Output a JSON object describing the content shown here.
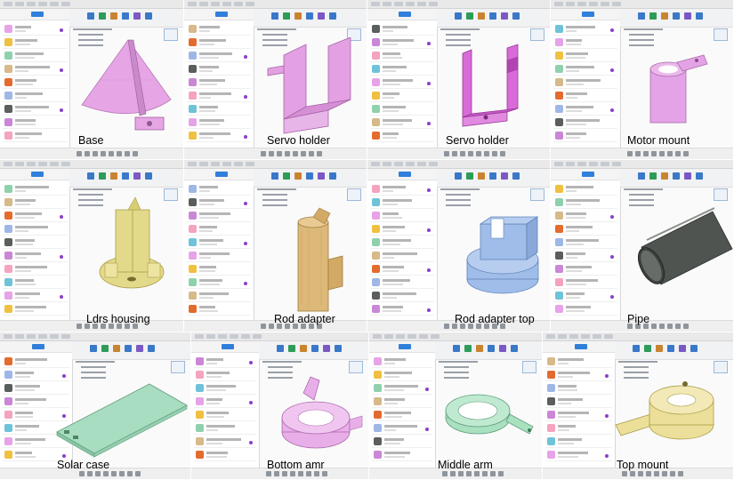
{
  "tiles": [
    {
      "label": "Base",
      "color": "#e6a6e6",
      "icon": "cone-base-model-icon"
    },
    {
      "label": "Servo holder",
      "color": "#e3a0e3",
      "icon": "servo-holder-model-icon"
    },
    {
      "label": "Servo holder",
      "color": "#d86bd8",
      "icon": "servo-holder-frame-model-icon"
    },
    {
      "label": "Motor mount",
      "color": "#e4a3e6",
      "icon": "motor-mount-model-icon"
    },
    {
      "label": "Ldrs housing",
      "color": "#e3d98a",
      "icon": "ldrs-housing-model-icon"
    },
    {
      "label": "Rod adapter",
      "color": "#ddb979",
      "icon": "rod-adapter-model-icon"
    },
    {
      "label": "Rod adapter top",
      "color": "#9fbde8",
      "icon": "rod-adapter-top-model-icon"
    },
    {
      "label": "Pipe",
      "color": "#4f5450",
      "icon": "pipe-model-icon"
    },
    {
      "label": "Solar case",
      "color": "#a9ddc1",
      "icon": "solar-case-model-icon"
    },
    {
      "label": "Bottom amr",
      "color": "#e8aee8",
      "icon": "bottom-arm-model-icon"
    },
    {
      "label": "Middle arm",
      "color": "#a8e0c0",
      "icon": "middle-arm-model-icon"
    },
    {
      "label": "Top mount",
      "color": "#ecdf9a",
      "icon": "top-mount-model-icon"
    }
  ]
}
